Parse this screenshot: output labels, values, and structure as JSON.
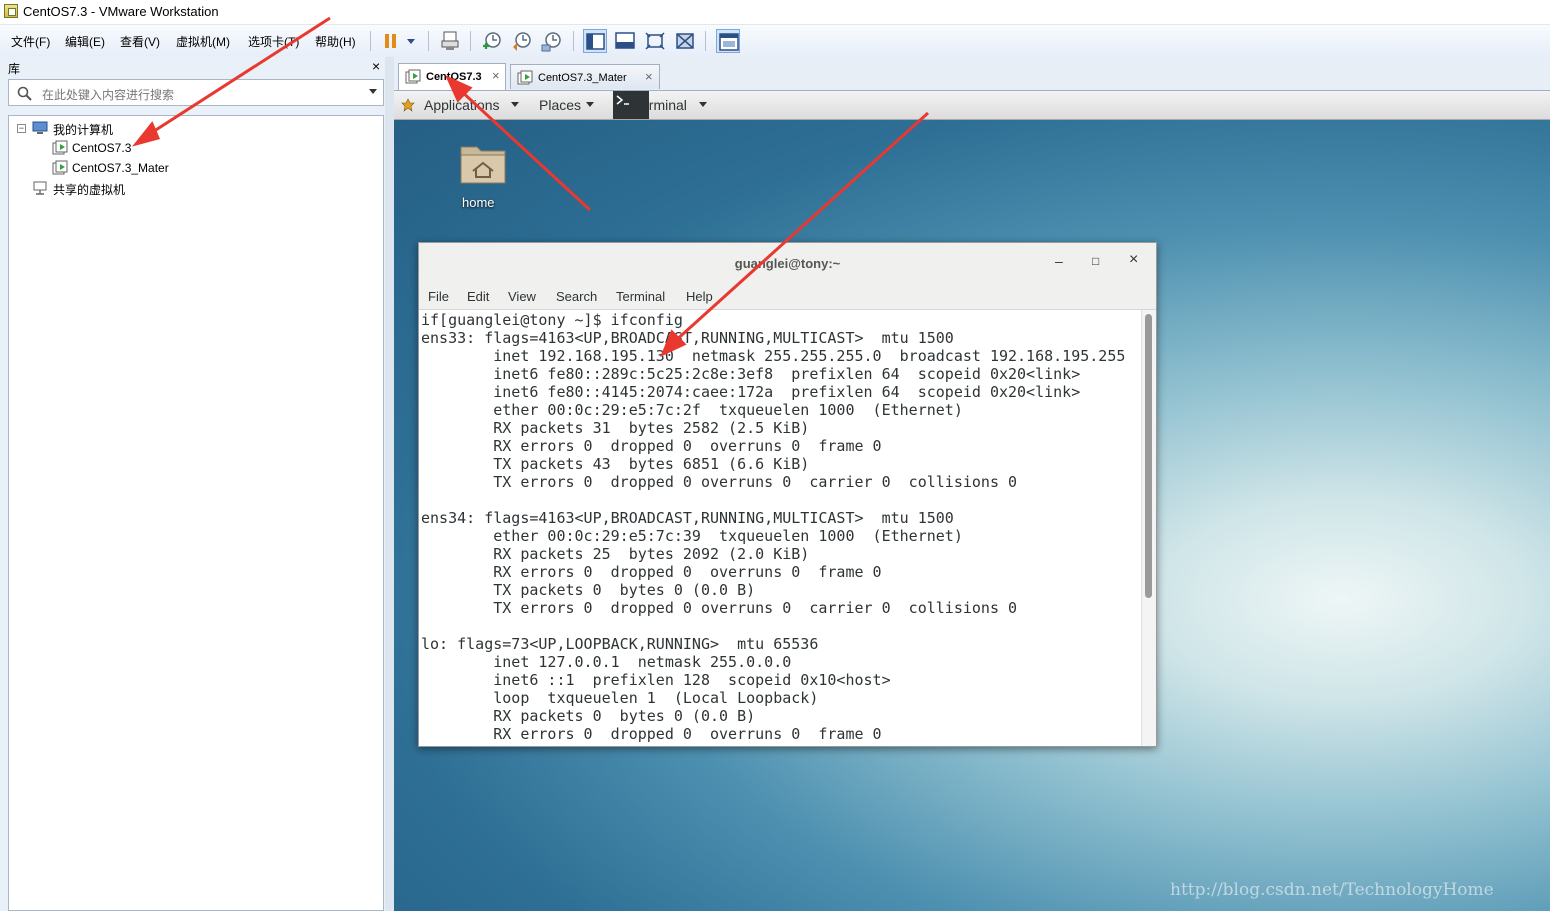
{
  "window": {
    "title": "CentOS7.3 - VMware Workstation"
  },
  "menubar": {
    "items": [
      "文件(F)",
      "编辑(E)",
      "查看(V)",
      "虚拟机(M)",
      "选项卡(T)",
      "帮助(H)"
    ]
  },
  "toolbar": {
    "buttons": [
      "pause-icon",
      "dropdown-icon",
      "send-ctrl-alt-del-icon",
      "snapshot-take-icon",
      "snapshot-revert-icon",
      "snapshot-manager-icon",
      "library-view-icon",
      "console-view-icon",
      "fullscreen-icon",
      "unity-icon",
      "thumbnail-view-icon"
    ]
  },
  "library": {
    "title": "库",
    "close": "×",
    "search_placeholder": "在此处键入内容进行搜索",
    "tree": {
      "my_computer": "我的计算机",
      "vm1": "CentOS7.3",
      "vm2": "CentOS7.3_Mater",
      "shared": "共享的虚拟机",
      "expander": "−"
    }
  },
  "vm_tabs": [
    {
      "label": "CentOS7.3",
      "close": "×"
    },
    {
      "label": "CentOS7.3_Mater",
      "close": "×"
    }
  ],
  "guest": {
    "top_bar": {
      "applications": "Applications",
      "places": "Places",
      "terminal": "Terminal"
    },
    "desktop": {
      "home_label": "home"
    },
    "terminal": {
      "title": "guanglei@tony:~",
      "controls": {
        "minimize": "–",
        "maximize": "□",
        "close": "×"
      },
      "menu": [
        "File",
        "Edit",
        "View",
        "Search",
        "Terminal",
        "Help"
      ],
      "output": "if[guanglei@tony ~]$ ifconfig\nens33: flags=4163<UP,BROADCAST,RUNNING,MULTICAST>  mtu 1500\n        inet 192.168.195.130  netmask 255.255.255.0  broadcast 192.168.195.255\n        inet6 fe80::289c:5c25:2c8e:3ef8  prefixlen 64  scopeid 0x20<link>\n        inet6 fe80::4145:2074:caee:172a  prefixlen 64  scopeid 0x20<link>\n        ether 00:0c:29:e5:7c:2f  txqueuelen 1000  (Ethernet)\n        RX packets 31  bytes 2582 (2.5 KiB)\n        RX errors 0  dropped 0  overruns 0  frame 0\n        TX packets 43  bytes 6851 (6.6 KiB)\n        TX errors 0  dropped 0 overruns 0  carrier 0  collisions 0\n\nens34: flags=4163<UP,BROADCAST,RUNNING,MULTICAST>  mtu 1500\n        ether 00:0c:29:e5:7c:39  txqueuelen 1000  (Ethernet)\n        RX packets 25  bytes 2092 (2.0 KiB)\n        RX errors 0  dropped 0  overruns 0  frame 0\n        TX packets 0  bytes 0 (0.0 B)\n        TX errors 0  dropped 0 overruns 0  carrier 0  collisions 0\n\nlo: flags=73<UP,LOOPBACK,RUNNING>  mtu 65536\n        inet 127.0.0.1  netmask 255.0.0.0\n        inet6 ::1  prefixlen 128  scopeid 0x10<host>\n        loop  txqueuelen 1  (Local Loopback)\n        RX packets 0  bytes 0 (0.0 B)\n        RX errors 0  dropped 0  overruns 0  frame 0"
    }
  },
  "watermark": "http://blog.csdn.net/TechnologyHome",
  "colors": {
    "annotation_arrow": "#e8382f",
    "desktop_blue": "#2e6f95",
    "toolbar_bg": "#e7eef8"
  }
}
